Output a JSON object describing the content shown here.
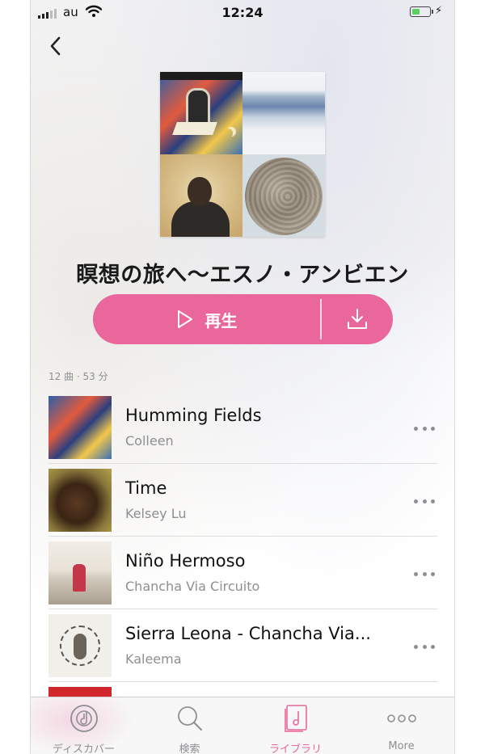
{
  "status_bar": {
    "carrier": "au",
    "time": "12:24",
    "battery_percent": 45
  },
  "playlist": {
    "title": "瞑想の旅へ〜エスノ・アンビエン",
    "play_label": "再生",
    "meta": "12 曲 · 53 分"
  },
  "tracks": [
    {
      "title": "Humming Fields",
      "artist": "Colleen"
    },
    {
      "title": "Time",
      "artist": "Kelsey Lu"
    },
    {
      "title": "Niño Hermoso",
      "artist": "Chancha Via Circuito"
    },
    {
      "title": "Sierra Leona - Chancha Via...",
      "artist": "Kaleema"
    }
  ],
  "tab_bar": [
    {
      "label": "ディスカバー",
      "icon": "discover-icon"
    },
    {
      "label": "検索",
      "icon": "search-icon"
    },
    {
      "label": "ライブラリ",
      "icon": "library-icon",
      "active": true
    },
    {
      "label": "More",
      "icon": "more-icon"
    }
  ],
  "colors": {
    "accent": "#e9679a",
    "battery": "#5bd25f",
    "secondary_text": "#8e8e93"
  }
}
